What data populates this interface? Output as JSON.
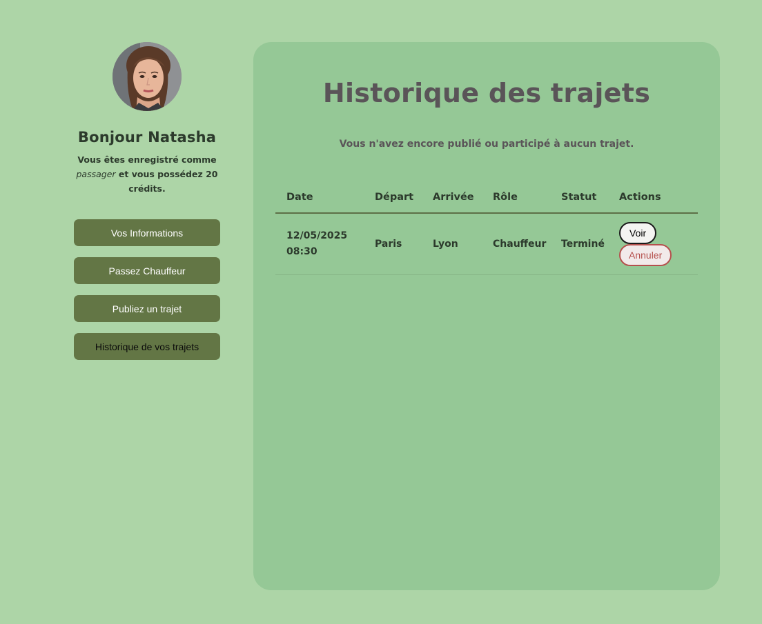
{
  "profile": {
    "greeting": "Bonjour Natasha",
    "status_prefix": "Vous êtes enregistré comme",
    "role": "passager",
    "status_mid": "et vous possédez",
    "credits": "20",
    "credits_unit": "crédits",
    "status_end": "."
  },
  "nav": {
    "items": [
      {
        "label": "Vos Informations"
      },
      {
        "label": "Passez Chauffeur"
      },
      {
        "label": "Publiez un trajet"
      },
      {
        "label": "Historique de vos trajets"
      }
    ]
  },
  "history": {
    "title": "Historique des trajets",
    "empty_message": "Vous n'avez encore publié ou participé à aucun trajet.",
    "columns": [
      "Date",
      "Départ",
      "Arrivée",
      "Rôle",
      "Statut",
      "Actions"
    ],
    "rows": [
      {
        "date": "12/05/2025",
        "time": "08:30",
        "depart": "Paris",
        "arrivee": "Lyon",
        "role": "Chauffeur",
        "statut": "Terminé",
        "action_view": "Voir",
        "action_cancel": "Annuler"
      }
    ]
  },
  "colors": {
    "page_bg": "#add5a7",
    "panel_bg": "#95c896",
    "nav_button": "#637645",
    "title_text": "#5a5458",
    "cancel_accent": "#b5504d"
  }
}
